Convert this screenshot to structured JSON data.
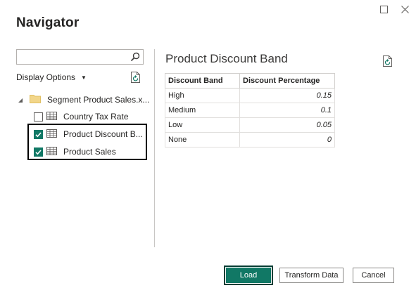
{
  "window": {
    "title": "Navigator",
    "maximize_icon": "maximize-icon",
    "close_icon": "close-icon"
  },
  "left_panel": {
    "search": {
      "value": "",
      "placeholder": ""
    },
    "display_options_label": "Display Options",
    "tree": {
      "root_label": "Segment Product Sales.x...",
      "items": [
        {
          "label": "Country Tax Rate",
          "checked": false
        },
        {
          "label": "Product Discount B...",
          "checked": true
        },
        {
          "label": "Product Sales",
          "checked": true
        }
      ]
    }
  },
  "preview": {
    "title": "Product Discount Band",
    "columns": [
      "Discount Band",
      "Discount Percentage"
    ],
    "rows": [
      [
        "High",
        "0.15"
      ],
      [
        "Medium",
        "0.1"
      ],
      [
        "Low",
        "0.05"
      ],
      [
        "None",
        "0"
      ]
    ]
  },
  "buttons": {
    "load": "Load",
    "transform": "Transform Data",
    "cancel": "Cancel"
  },
  "colors": {
    "accent": "#117865",
    "text": "#252423",
    "border": "#8a8886"
  }
}
